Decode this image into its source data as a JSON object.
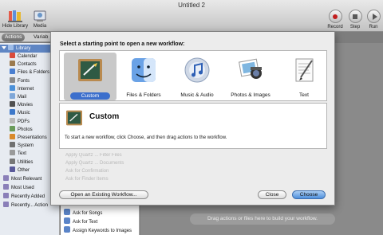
{
  "window": {
    "title": "Untitled 2"
  },
  "toolbar": {
    "hide_library": "Hide Library",
    "media": "Media",
    "record": "Record",
    "step": "Step",
    "run": "Run"
  },
  "library_tabs": {
    "actions": "Actions",
    "variables": "Variab"
  },
  "library": {
    "root": "Library",
    "items": [
      {
        "label": "Calendar",
        "color": "#d94c3d"
      },
      {
        "label": "Contacts",
        "color": "#9b7a4e"
      },
      {
        "label": "Files & Folders",
        "color": "#4a7fd0"
      },
      {
        "label": "Fonts",
        "color": "#8a8a8a"
      },
      {
        "label": "Internet",
        "color": "#4a90d9"
      },
      {
        "label": "Mail",
        "color": "#7fa7d8"
      },
      {
        "label": "Movies",
        "color": "#505050"
      },
      {
        "label": "Music",
        "color": "#3d78c9"
      },
      {
        "label": "PDFs",
        "color": "#b8b8b8"
      },
      {
        "label": "Photos",
        "color": "#6a9b5a"
      },
      {
        "label": "Presentations",
        "color": "#d98a2b"
      },
      {
        "label": "System",
        "color": "#707070"
      },
      {
        "label": "Text",
        "color": "#9a9a9a"
      },
      {
        "label": "Utilities",
        "color": "#777777"
      },
      {
        "label": "Other",
        "color": "#5a5a9a"
      }
    ],
    "groups": [
      "Most Relevant",
      "Most Used",
      "Recently Added",
      "Recently... Action"
    ]
  },
  "actions_list": [
    "Ask for Songs",
    "Ask for Text",
    "Assign Keywords to Images"
  ],
  "sheet": {
    "prompt": "Select a starting point to open a new workflow:",
    "choices": [
      {
        "label": "Custom",
        "icon": "automator-slate-icon",
        "selected": true
      },
      {
        "label": "Files & Folders",
        "icon": "finder-icon",
        "selected": false
      },
      {
        "label": "Music & Audio",
        "icon": "itunes-icon",
        "selected": false
      },
      {
        "label": "Photos & Images",
        "icon": "iphoto-icon",
        "selected": false
      },
      {
        "label": "Text",
        "icon": "textedit-icon",
        "selected": false
      }
    ],
    "detail_title": "Custom",
    "detail_desc": "To start a new workflow, click Choose, and then drag actions to the workflow.",
    "ghost_items": [
      "Apply Quartz ... Filter Files",
      "Apply Quartz ... Documents",
      "Ask for Confirmation",
      "Ask for Finder Items"
    ],
    "open_existing": "Open an Existing Workflow...",
    "close": "Close",
    "choose": "Choose"
  },
  "workflow": {
    "hint": "Drag actions or files here to build your workflow."
  },
  "colors": {
    "accent": "#3c6fcc",
    "record": "#c21d1d"
  }
}
